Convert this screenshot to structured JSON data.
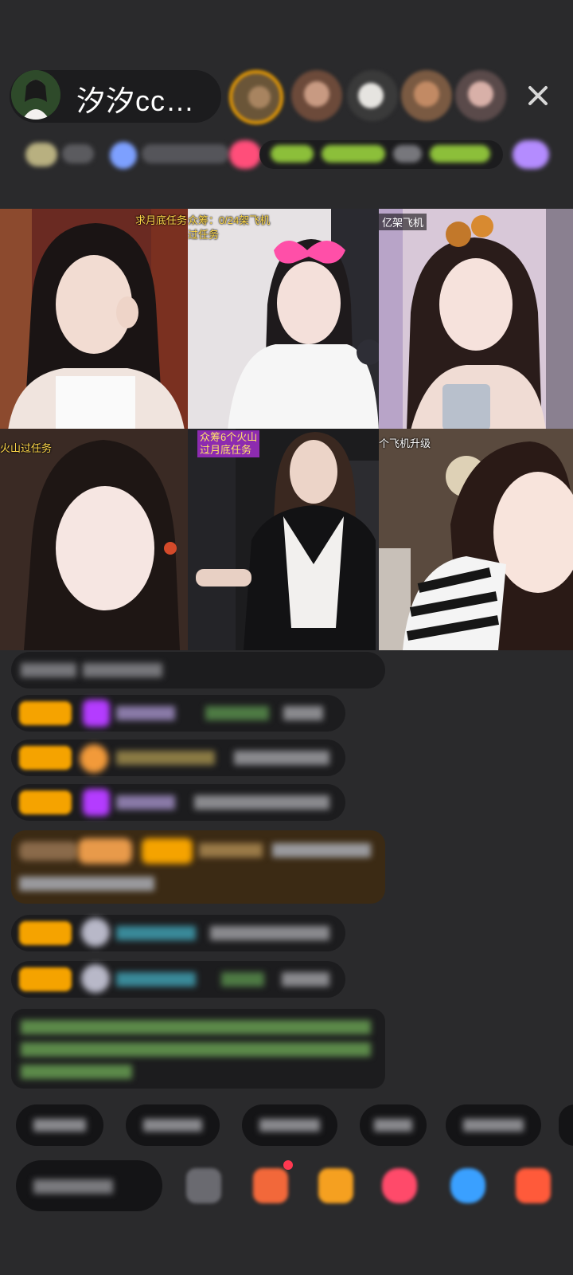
{
  "host": {
    "name": "汐汐cc…",
    "avatar_icon": "host-avatar"
  },
  "viewers": [
    "viewer-1",
    "viewer-2",
    "viewer-3",
    "viewer-4",
    "viewer-5"
  ],
  "grid": {
    "tiles": [
      {
        "tag": "求月底任务"
      },
      {
        "tag": "众筹：0/24架飞机",
        "tag2": "过任务"
      },
      {
        "tag": "亿架飞机"
      },
      {
        "tag": "火山过任务"
      },
      {
        "tag": "众筹6个火山",
        "tag2": "过月底任务"
      },
      {
        "tag": "个飞机升级"
      }
    ]
  },
  "colors": {
    "background": "#2a2a2c",
    "badge": "#f5a300",
    "purple": "#b43cff",
    "chat_bg": "#1a1a1c",
    "highlight_bg": "#3b2a14"
  }
}
